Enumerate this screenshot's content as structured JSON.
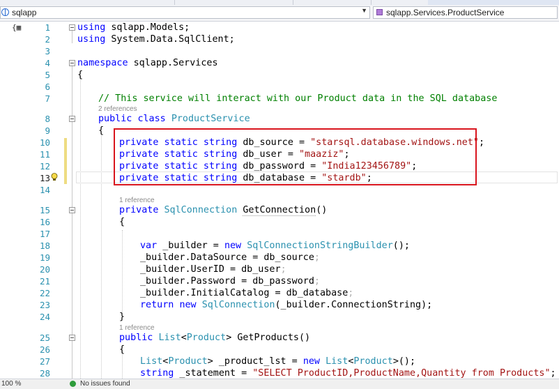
{
  "navbar": {
    "project_label": "sqlapp",
    "class_label": "sqlapp.Services.ProductService"
  },
  "codelens": {
    "refs_2": "2 references",
    "refs_1a": "1 reference",
    "refs_1b": "1 reference"
  },
  "lines": {
    "n1": "1",
    "n2": "2",
    "n3": "3",
    "n4": "4",
    "n5": "5",
    "n6": "6",
    "n7": "7",
    "n8": "8",
    "n9": "9",
    "n10": "10",
    "n11": "11",
    "n12": "12",
    "n13": "13",
    "n14": "14",
    "n15": "15",
    "n16": "16",
    "n17": "17",
    "n18": "18",
    "n19": "19",
    "n20": "20",
    "n21": "21",
    "n22": "22",
    "n23": "23",
    "n24": "24",
    "n25": "25",
    "n26": "26",
    "n27": "27",
    "n28": "28"
  },
  "code": {
    "l1_using": "using",
    "l1_rest": " sqlapp.Models;",
    "l2_using": "using",
    "l2_rest": " System.Data.SqlClient;",
    "l4_ns": "namespace",
    "l4_rest": " sqlapp.Services",
    "l5": "{",
    "l7_comment": "// This service will interact with our Product data in the SQL database",
    "l8_public": "public",
    "l8_class": "class",
    "l8_name": "ProductService",
    "l9": "{",
    "field_mods": "private static string",
    "l10_name": " db_source = ",
    "l10_value": "\"starsql.database.windows.net\"",
    "l11_name": " db_user = ",
    "l11_value": "\"maaziz\"",
    "l12_name": " db_password = ",
    "l12_value": "\"India123456789\"",
    "l13_name": " db_database = ",
    "l13_value": "\"stardb\"",
    "semi": ";",
    "l15_private": "private",
    "l15_type": "SqlConnection",
    "l15_method": "GetConnection",
    "l15_paren": "()",
    "l16": "{",
    "l18_var": "var",
    "l18_mid": " _builder = ",
    "l18_new": "new",
    "l18_type": "SqlConnectionStringBuilder",
    "l18_end": "();",
    "l19": "_builder.DataSource = db_source",
    "l20_a": "_builder.",
    "l20_b": "UserID",
    "l20_c": " = db_user",
    "l21": "_builder.Password = db_password",
    "l22": "_builder.InitialCatalog = db_database",
    "l23_return": "return",
    "l23_new": "new",
    "l23_type": "SqlConnection",
    "l23_end": "(_builder.ConnectionString);",
    "l24": "}",
    "l25_public": "public",
    "l25_list": "List",
    "l25_product": "Product",
    "l25_method": "GetProducts",
    "l25_end": "()",
    "l26": "{",
    "l27_list": "List",
    "l27_product": "Product",
    "l27_mid": " _product_lst = ",
    "l27_new": "new",
    "l27_end": "();",
    "l28_string": "string",
    "l28_mid": " _statement = ",
    "l28_value": "\"SELECT ProductID,ProductName,Quantity from Products\"",
    "l28_end": ";"
  },
  "status": {
    "zoom": "100 %",
    "message": "No issues found"
  },
  "colors": {
    "keyword": "#0000ff",
    "type": "#2b91af",
    "string": "#a31515",
    "comment": "#008000",
    "highlight_box": "#d9151e"
  }
}
